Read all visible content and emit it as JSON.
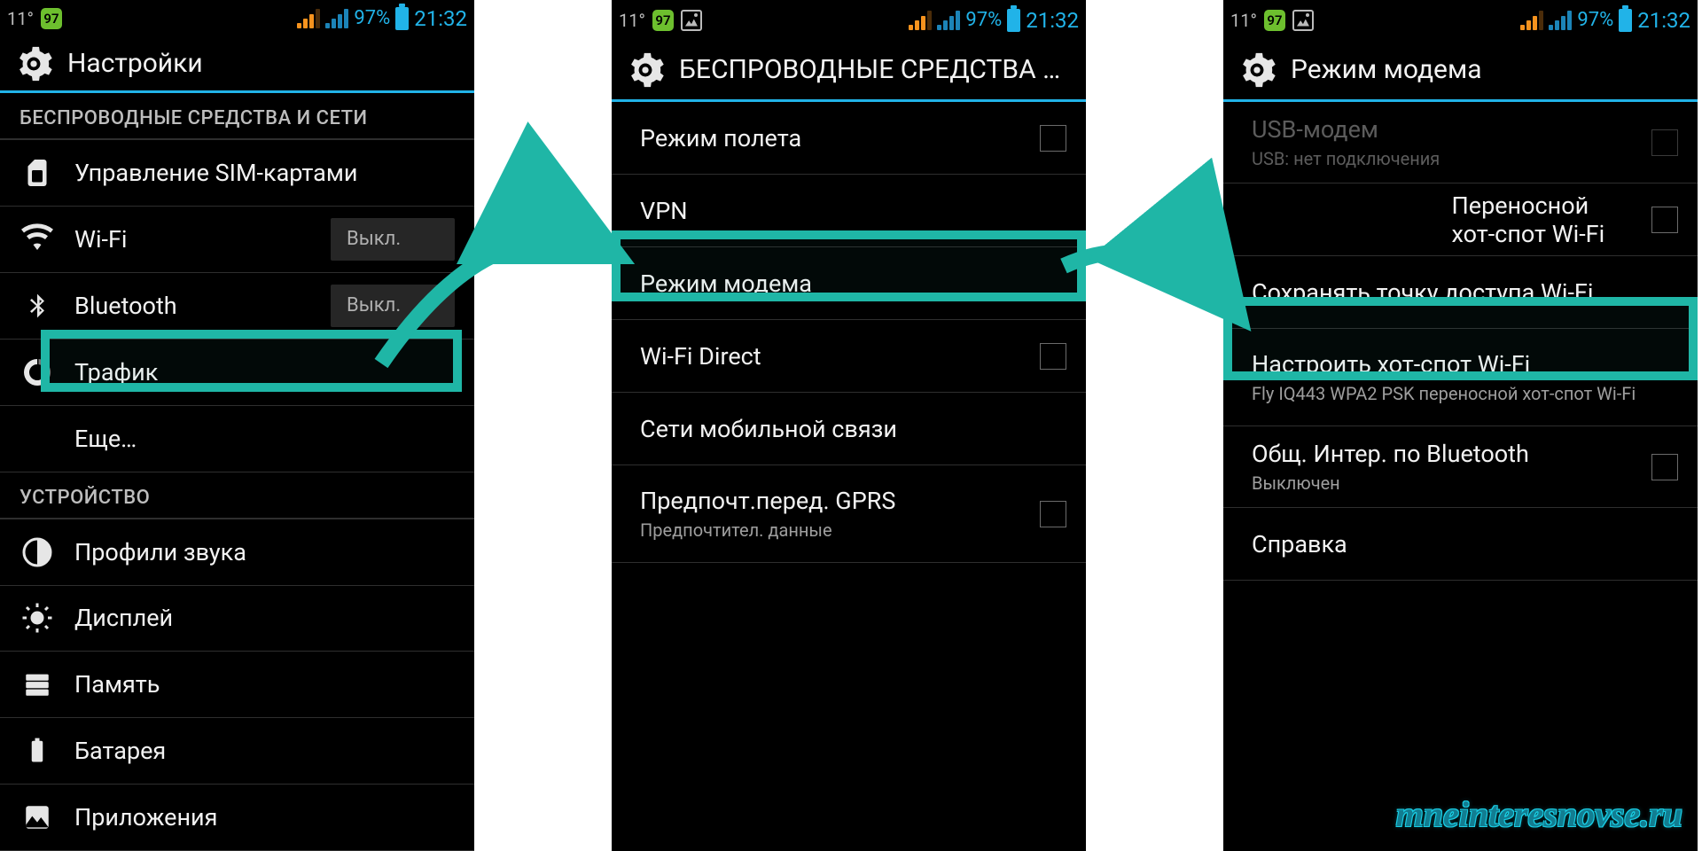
{
  "status": {
    "temp": "11°",
    "badge": "97",
    "battery_pct": "97%",
    "clock": "21:32"
  },
  "screen1": {
    "title": "Настройки",
    "section1": "БЕСПРОВОДНЫЕ СРЕДСТВА И СЕТИ",
    "sim": "Управление SIM-картами",
    "wifi": "Wi-Fi",
    "wifi_state": "Выкл.",
    "bt": "Bluetooth",
    "bt_state": "Выкл.",
    "traffic": "Трафик",
    "more": "Еще…",
    "section2": "УСТРОЙСТВО",
    "sound": "Профили звука",
    "display": "Дисплей",
    "memory": "Память",
    "battery": "Батарея",
    "apps": "Приложения"
  },
  "screen2": {
    "title": "БЕСПРОВОДНЫЕ СРЕДСТВА И СЕ…",
    "airplane": "Режим полета",
    "vpn": "VPN",
    "tether": "Режим модема",
    "wifidirect": "Wi-Fi Direct",
    "mobile": "Сети мобильной связи",
    "gprs": "Предпочт.перед. GPRS",
    "gprs_sub": "Предпочтител. данные"
  },
  "screen3": {
    "title": "Режим модема",
    "usb": "USB-модем",
    "usb_sub": "USB: нет подключения",
    "hotspot": "Переносной хот-спот Wi-Fi",
    "keep": "Сохранять точку доступа Wi-Fi",
    "setup": "Настроить хот-спот Wi-Fi",
    "setup_sub": "Fly IQ443 WPA2 PSK переносной хот-спот Wi-Fi",
    "btshare": "Общ. Интер. по Bluetooth",
    "btshare_sub": "Выключен",
    "help": "Справка"
  },
  "watermark": "mneinteresnovse.ru"
}
